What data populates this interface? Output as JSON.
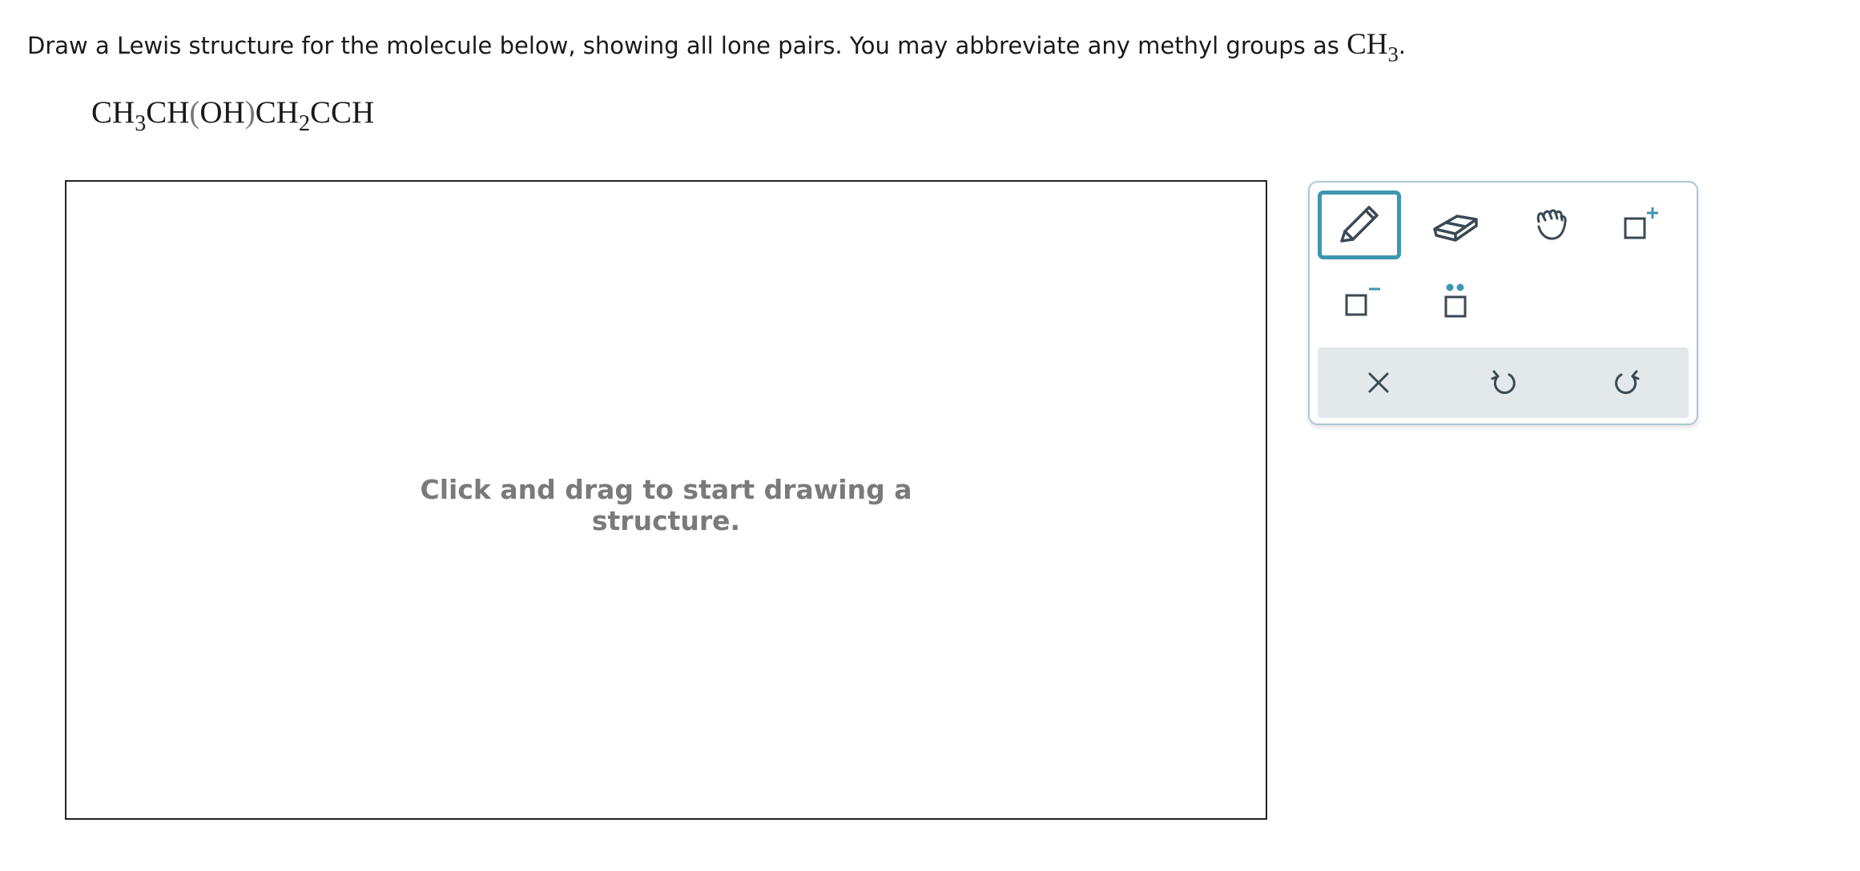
{
  "prompt": {
    "text": "Draw a Lewis structure for the molecule below, showing all lone pairs. You may abbreviate any methyl groups as ",
    "abbr_main": "CH",
    "abbr_sub": "3",
    "period": "."
  },
  "formula": {
    "p1": "CH",
    "s1": "3",
    "p2": "CH",
    "open": "(",
    "p3": "OH",
    "close": ")",
    "p4": "CH",
    "s2": "2",
    "p5": "CCH"
  },
  "canvas": {
    "hint_line1": "Click and drag to start drawing a",
    "hint_line2": "structure."
  },
  "toolbox": {
    "tools": [
      {
        "name": "pencil",
        "icon": "pencil-icon",
        "active": true
      },
      {
        "name": "eraser",
        "icon": "eraser-icon",
        "active": false
      },
      {
        "name": "hand",
        "icon": "hand-icon",
        "active": false
      },
      {
        "name": "positive-charge",
        "icon": "square-plus-icon",
        "active": false
      },
      {
        "name": "negative-charge",
        "icon": "square-minus-icon",
        "active": false
      },
      {
        "name": "lone-pair",
        "icon": "square-lone-pair-icon",
        "active": false
      }
    ],
    "actions": [
      {
        "name": "clear",
        "icon": "close-icon"
      },
      {
        "name": "undo",
        "icon": "undo-icon"
      },
      {
        "name": "redo",
        "icon": "redo-icon"
      }
    ],
    "colors": {
      "accent": "#3c97b0",
      "icon": "#3a4a55",
      "charge": "#3c97b0",
      "action_bg": "#e3e8ea"
    }
  }
}
